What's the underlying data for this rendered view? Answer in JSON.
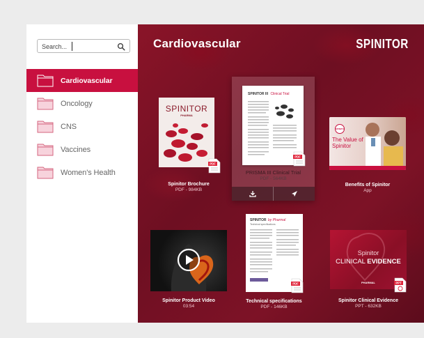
{
  "search": {
    "placeholder": "Search..."
  },
  "sidebar": {
    "items": [
      {
        "label": "Cardiovascular",
        "active": true
      },
      {
        "label": "Oncology"
      },
      {
        "label": "CNS"
      },
      {
        "label": "Vaccines"
      },
      {
        "label": "Women's Health"
      }
    ]
  },
  "main": {
    "title": "Cardiovascular",
    "brand": "SPINITOR"
  },
  "cards": [
    {
      "title": "Spinitor Brochure",
      "meta": "PDF - 984KB",
      "cover_title": "SPINITOR",
      "cover_sub": "PHARMA"
    },
    {
      "title": "PRISMA III Clinical Trial",
      "meta": "PDF - 564KB",
      "cover_title": "SPINITOR III",
      "cover_sub": "Clinical Trial"
    },
    {
      "title": "Benefits of Spinitor",
      "meta": "App",
      "cover_title": "The Value of Spinitor",
      "cover_logo": "SPINITOR"
    },
    {
      "title": "Spinitor Product Video",
      "meta": "03:54"
    },
    {
      "title": "Technical specifications",
      "meta": "PDF - 146KB",
      "cover_title": "SPINITOR",
      "cover_sub": "by Pharmal",
      "cover_sub2": "Technical specifications"
    },
    {
      "title": "Spinitor Clinical Evidence",
      "meta": "PPT - 632KB",
      "cover_line1": "Spinitor",
      "cover_line2a": "CLINICAL",
      "cover_line2b": "EVIDENCE",
      "cover_foot": "PHARMAL"
    }
  ],
  "badges": {
    "pdf": "PDF",
    "ppt": "PPT"
  },
  "colors": {
    "accent": "#c8103f",
    "folder": "#f4c9d3",
    "folder_stroke": "#c8103f",
    "main_bg": "#7a1226"
  },
  "icons": {
    "search": "search-icon",
    "folder": "folder-icon",
    "download": "download-icon",
    "send": "send-icon",
    "play": "play-icon"
  }
}
